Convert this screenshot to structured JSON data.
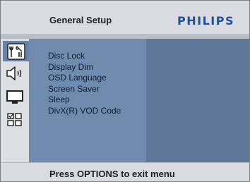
{
  "header": {
    "title": "General Setup",
    "brand": "PHILIPS"
  },
  "sidebar": {
    "items": [
      {
        "icon": "general-setup-tools-icon",
        "active": true
      },
      {
        "icon": "speaker-icon",
        "active": false
      },
      {
        "icon": "tv-monitor-icon",
        "active": false
      },
      {
        "icon": "preference-grid-icon",
        "active": false
      }
    ]
  },
  "menu": {
    "items": [
      {
        "label": "Disc Lock"
      },
      {
        "label": "Display Dim"
      },
      {
        "label": "OSD Language"
      },
      {
        "label": "Screen Saver"
      },
      {
        "label": "Sleep"
      },
      {
        "label": "DivX(R) VOD Code"
      }
    ]
  },
  "footer": {
    "hint": "Press OPTIONS to exit menu"
  },
  "colors": {
    "header_bg": "#d9dbe0",
    "menu_panel": "#6f8bad",
    "value_panel": "#5f7899",
    "active_icon_bg": "#6883a6",
    "brand": "#1f4f96"
  }
}
